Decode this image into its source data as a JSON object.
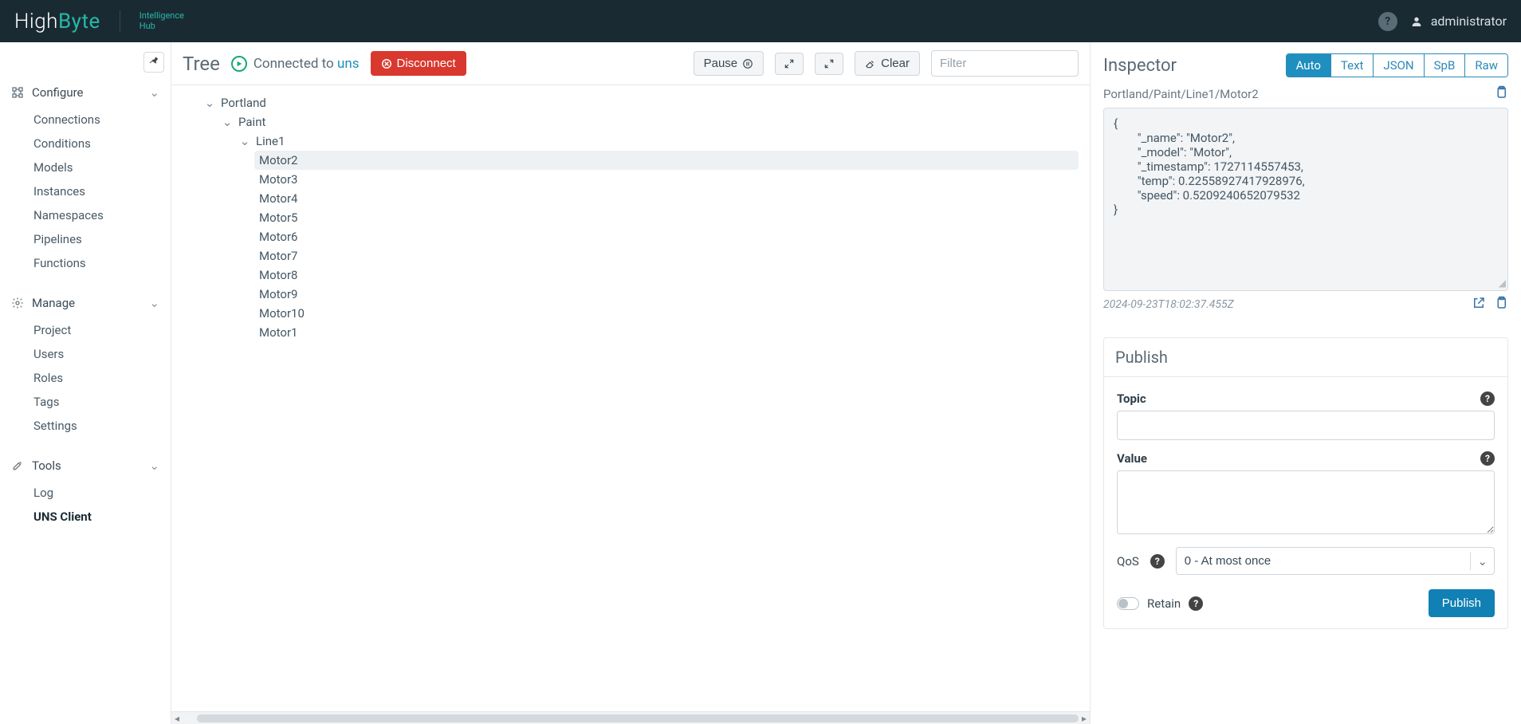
{
  "header": {
    "brand_high": "High",
    "brand_byte": "Byte",
    "brand_sub": "Intelligence\nHub",
    "username": "administrator"
  },
  "sidebar": {
    "sections": {
      "configure": {
        "title": "Configure",
        "items": [
          "Connections",
          "Conditions",
          "Models",
          "Instances",
          "Namespaces",
          "Pipelines",
          "Functions"
        ]
      },
      "manage": {
        "title": "Manage",
        "items": [
          "Project",
          "Users",
          "Roles",
          "Tags",
          "Settings"
        ]
      },
      "tools": {
        "title": "Tools",
        "items": [
          "Log",
          "UNS Client"
        ],
        "active": "UNS Client"
      }
    }
  },
  "center": {
    "title": "Tree",
    "status_prefix": "Connected to ",
    "status_target": "uns",
    "disconnect": "Disconnect",
    "pause": "Pause",
    "clear": "Clear",
    "filter_placeholder": "Filter",
    "tree": {
      "root": "Portland",
      "l1": "Paint",
      "l2": "Line1",
      "motors": [
        "Motor2",
        "Motor3",
        "Motor4",
        "Motor5",
        "Motor6",
        "Motor7",
        "Motor8",
        "Motor9",
        "Motor10",
        "Motor1"
      ],
      "selected": "Motor2"
    }
  },
  "inspector": {
    "title": "Inspector",
    "tabs": [
      "Auto",
      "Text",
      "JSON",
      "SpB",
      "Raw"
    ],
    "active_tab": "Auto",
    "path": "Portland/Paint/Line1/Motor2",
    "json": "{\n        \"_name\": \"Motor2\",\n        \"_model\": \"Motor\",\n        \"_timestamp\": 1727114557453,\n        \"temp\": 0.22558927417928976,\n        \"speed\": 0.5209240652079532\n}",
    "timestamp": "2024-09-23T18:02:37.455Z",
    "publish": {
      "title": "Publish",
      "topic_label": "Topic",
      "value_label": "Value",
      "qos_label": "QoS",
      "qos_selected": "0 - At most once",
      "retain_label": "Retain",
      "publish_btn": "Publish"
    }
  }
}
